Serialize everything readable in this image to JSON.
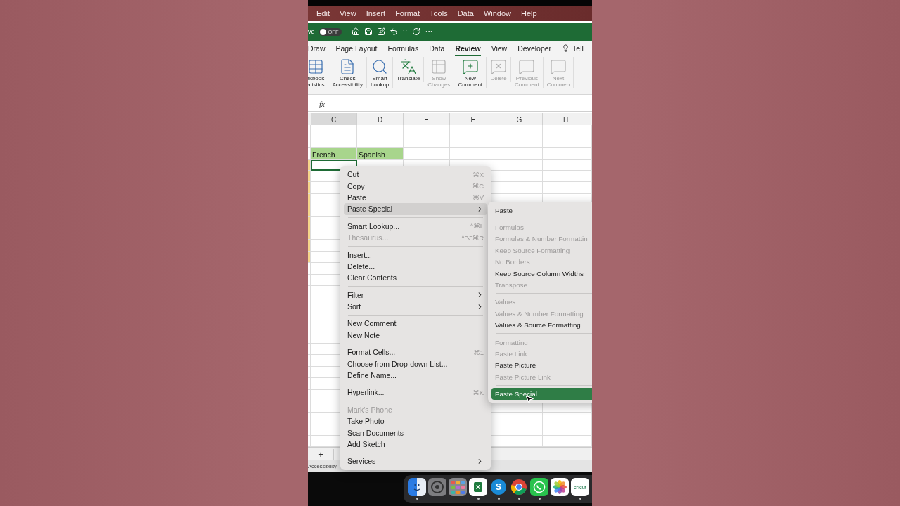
{
  "menu_bar": [
    "Edit",
    "View",
    "Insert",
    "Format",
    "Tools",
    "Data",
    "Window",
    "Help"
  ],
  "toolbar": {
    "autosave_label": "ve",
    "autosave_state": "OFF",
    "autosave_on": false
  },
  "tabs": [
    {
      "label": "Draw",
      "selected": false
    },
    {
      "label": "Page Layout",
      "selected": false
    },
    {
      "label": "Formulas",
      "selected": false
    },
    {
      "label": "Data",
      "selected": false
    },
    {
      "label": "Review",
      "selected": true
    },
    {
      "label": "View",
      "selected": false
    },
    {
      "label": "Developer",
      "selected": false
    },
    {
      "label": "Tell",
      "selected": false,
      "kind": "search"
    }
  ],
  "ribbon": [
    {
      "kind": "statistics",
      "lines": [
        "rkbook",
        "atistics"
      ],
      "disabled": false
    },
    {
      "kind": "accessibility",
      "lines": [
        "Check",
        "Accessibility"
      ],
      "disabled": false
    },
    {
      "kind": "lookup",
      "lines": [
        "Smart",
        "Lookup"
      ],
      "disabled": false
    },
    {
      "kind": "translate",
      "lines": [
        "Translate"
      ],
      "disabled": false
    },
    {
      "kind": "changes",
      "lines": [
        "Show",
        "Changes"
      ],
      "disabled": true
    },
    {
      "kind": "new-comment",
      "lines": [
        "New",
        "Comment"
      ],
      "disabled": false
    },
    {
      "kind": "delete-comment",
      "lines": [
        "Delete"
      ],
      "disabled": true
    },
    {
      "kind": "prev-comment",
      "lines": [
        "Previous",
        "Comment"
      ],
      "disabled": true
    },
    {
      "kind": "next-comment",
      "lines": [
        "Next",
        "Commen"
      ],
      "disabled": true
    }
  ],
  "formula_bar": {
    "fx": "fx"
  },
  "sheet": {
    "columns": [
      {
        "label": "C",
        "selected": true
      },
      {
        "label": "D",
        "selected": false
      },
      {
        "label": "E",
        "selected": false
      },
      {
        "label": "F",
        "selected": false
      },
      {
        "label": "G",
        "selected": false
      },
      {
        "label": "H",
        "selected": false
      }
    ],
    "rows": [
      {
        "kind": "blank"
      },
      {
        "kind": "blank"
      },
      {
        "kind": "header",
        "cells": [
          "French",
          "Spanish"
        ]
      },
      {
        "kind": "active"
      }
    ],
    "add_sheet": "+",
    "status": "Accessibility"
  },
  "context_menu": [
    [
      {
        "label": "Cut",
        "shortcut": "⌘X",
        "disabled": false,
        "selected": false
      },
      {
        "label": "Copy",
        "shortcut": "⌘C",
        "disabled": false,
        "selected": false
      },
      {
        "label": "Paste",
        "shortcut": "⌘V",
        "disabled": false,
        "selected": false
      },
      {
        "label": "Paste Special",
        "submenu": true,
        "disabled": false,
        "selected": true
      }
    ],
    [
      {
        "label": "Smart Lookup...",
        "shortcut": "^⌘L",
        "disabled": false,
        "selected": false
      },
      {
        "label": "Thesaurus...",
        "shortcut": "^⌥⌘R",
        "disabled": true,
        "selected": false
      }
    ],
    [
      {
        "label": "Insert...",
        "disabled": false,
        "selected": false
      },
      {
        "label": "Delete...",
        "disabled": false,
        "selected": false
      },
      {
        "label": "Clear Contents",
        "disabled": false,
        "selected": false
      }
    ],
    [
      {
        "label": "Filter",
        "submenu": true,
        "disabled": false,
        "selected": false
      },
      {
        "label": "Sort",
        "submenu": true,
        "disabled": false,
        "selected": false
      }
    ],
    [
      {
        "label": "New Comment",
        "disabled": false,
        "selected": false
      },
      {
        "label": "New Note",
        "disabled": false,
        "selected": false
      }
    ],
    [
      {
        "label": "Format Cells...",
        "shortcut": "⌘1",
        "disabled": false,
        "selected": false
      },
      {
        "label": "Choose from Drop-down List...",
        "disabled": false,
        "selected": false
      },
      {
        "label": "Define Name...",
        "disabled": false,
        "selected": false
      }
    ],
    [
      {
        "label": "Hyperlink...",
        "shortcut": "⌘K",
        "disabled": false,
        "selected": false
      }
    ],
    [
      {
        "label": "Mark's Phone",
        "disabled": true,
        "selected": false
      },
      {
        "label": "Take Photo",
        "disabled": false,
        "selected": false
      },
      {
        "label": "Scan Documents",
        "disabled": false,
        "selected": false
      },
      {
        "label": "Add Sketch",
        "disabled": false,
        "selected": false
      }
    ],
    [
      {
        "label": "Services",
        "submenu": true,
        "disabled": false,
        "selected": false
      }
    ]
  ],
  "submenu": [
    [
      {
        "label": "Paste",
        "disabled": false,
        "selected": false
      }
    ],
    [
      {
        "label": "Formulas",
        "disabled": true,
        "selected": false
      },
      {
        "label": "Formulas & Number Formattin",
        "disabled": true,
        "selected": false
      },
      {
        "label": "Keep Source Formatting",
        "disabled": true,
        "selected": false
      },
      {
        "label": "No Borders",
        "disabled": true,
        "selected": false
      },
      {
        "label": "Keep Source Column Widths",
        "disabled": false,
        "selected": false
      },
      {
        "label": "Transpose",
        "disabled": true,
        "selected": false
      }
    ],
    [
      {
        "label": "Values",
        "disabled": true,
        "selected": false
      },
      {
        "label": "Values & Number Formatting",
        "disabled": true,
        "selected": false
      },
      {
        "label": "Values & Source Formatting",
        "disabled": false,
        "selected": false
      }
    ],
    [
      {
        "label": "Formatting",
        "disabled": true,
        "selected": false
      },
      {
        "label": "Paste Link",
        "disabled": true,
        "selected": false
      },
      {
        "label": "Paste Picture",
        "disabled": false,
        "selected": false
      },
      {
        "label": "Paste Picture Link",
        "disabled": true,
        "selected": false
      }
    ],
    [
      {
        "label": "Paste Special...",
        "disabled": false,
        "selected": true
      }
    ]
  ],
  "dock": [
    {
      "kind": "finder",
      "running": true
    },
    {
      "kind": "settings",
      "running": false
    },
    {
      "kind": "launchpad",
      "running": false
    },
    {
      "kind": "excel",
      "label": "X",
      "running": true
    },
    {
      "kind": "skype",
      "label": "S",
      "running": true
    },
    {
      "kind": "chrome",
      "running": true
    },
    {
      "kind": "whatsapp",
      "running": true
    },
    {
      "kind": "photos",
      "running": false
    },
    {
      "kind": "cricut",
      "label": "cricut",
      "running": true
    }
  ]
}
